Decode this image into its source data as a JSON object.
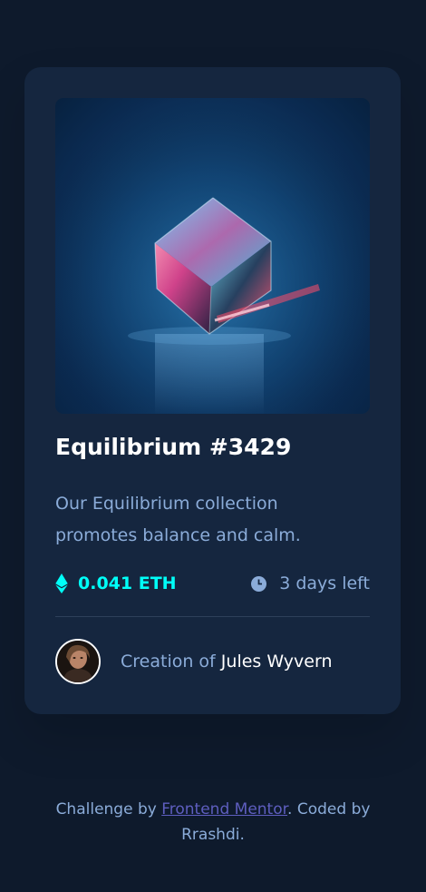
{
  "card": {
    "title": "Equilibrium #3429",
    "description": "Our Equilibrium collection promotes balance and calm.",
    "price": "0.041 ETH",
    "time_left": "3 days left",
    "creator_prefix": "Creation of",
    "creator_name": "Jules Wyvern",
    "icons": {
      "price": "ethereum-icon",
      "time": "clock-icon"
    }
  },
  "attribution": {
    "prefix": "Challenge by",
    "link": "Frontend Mentor",
    "suffix": ". Coded by",
    "author": "Rrashdi."
  },
  "colors": {
    "page_bg": "#0e1a2c",
    "card_bg": "#15263f",
    "accent": "#00fff8",
    "muted": "#8bacd9",
    "link": "#5e5ebf"
  }
}
